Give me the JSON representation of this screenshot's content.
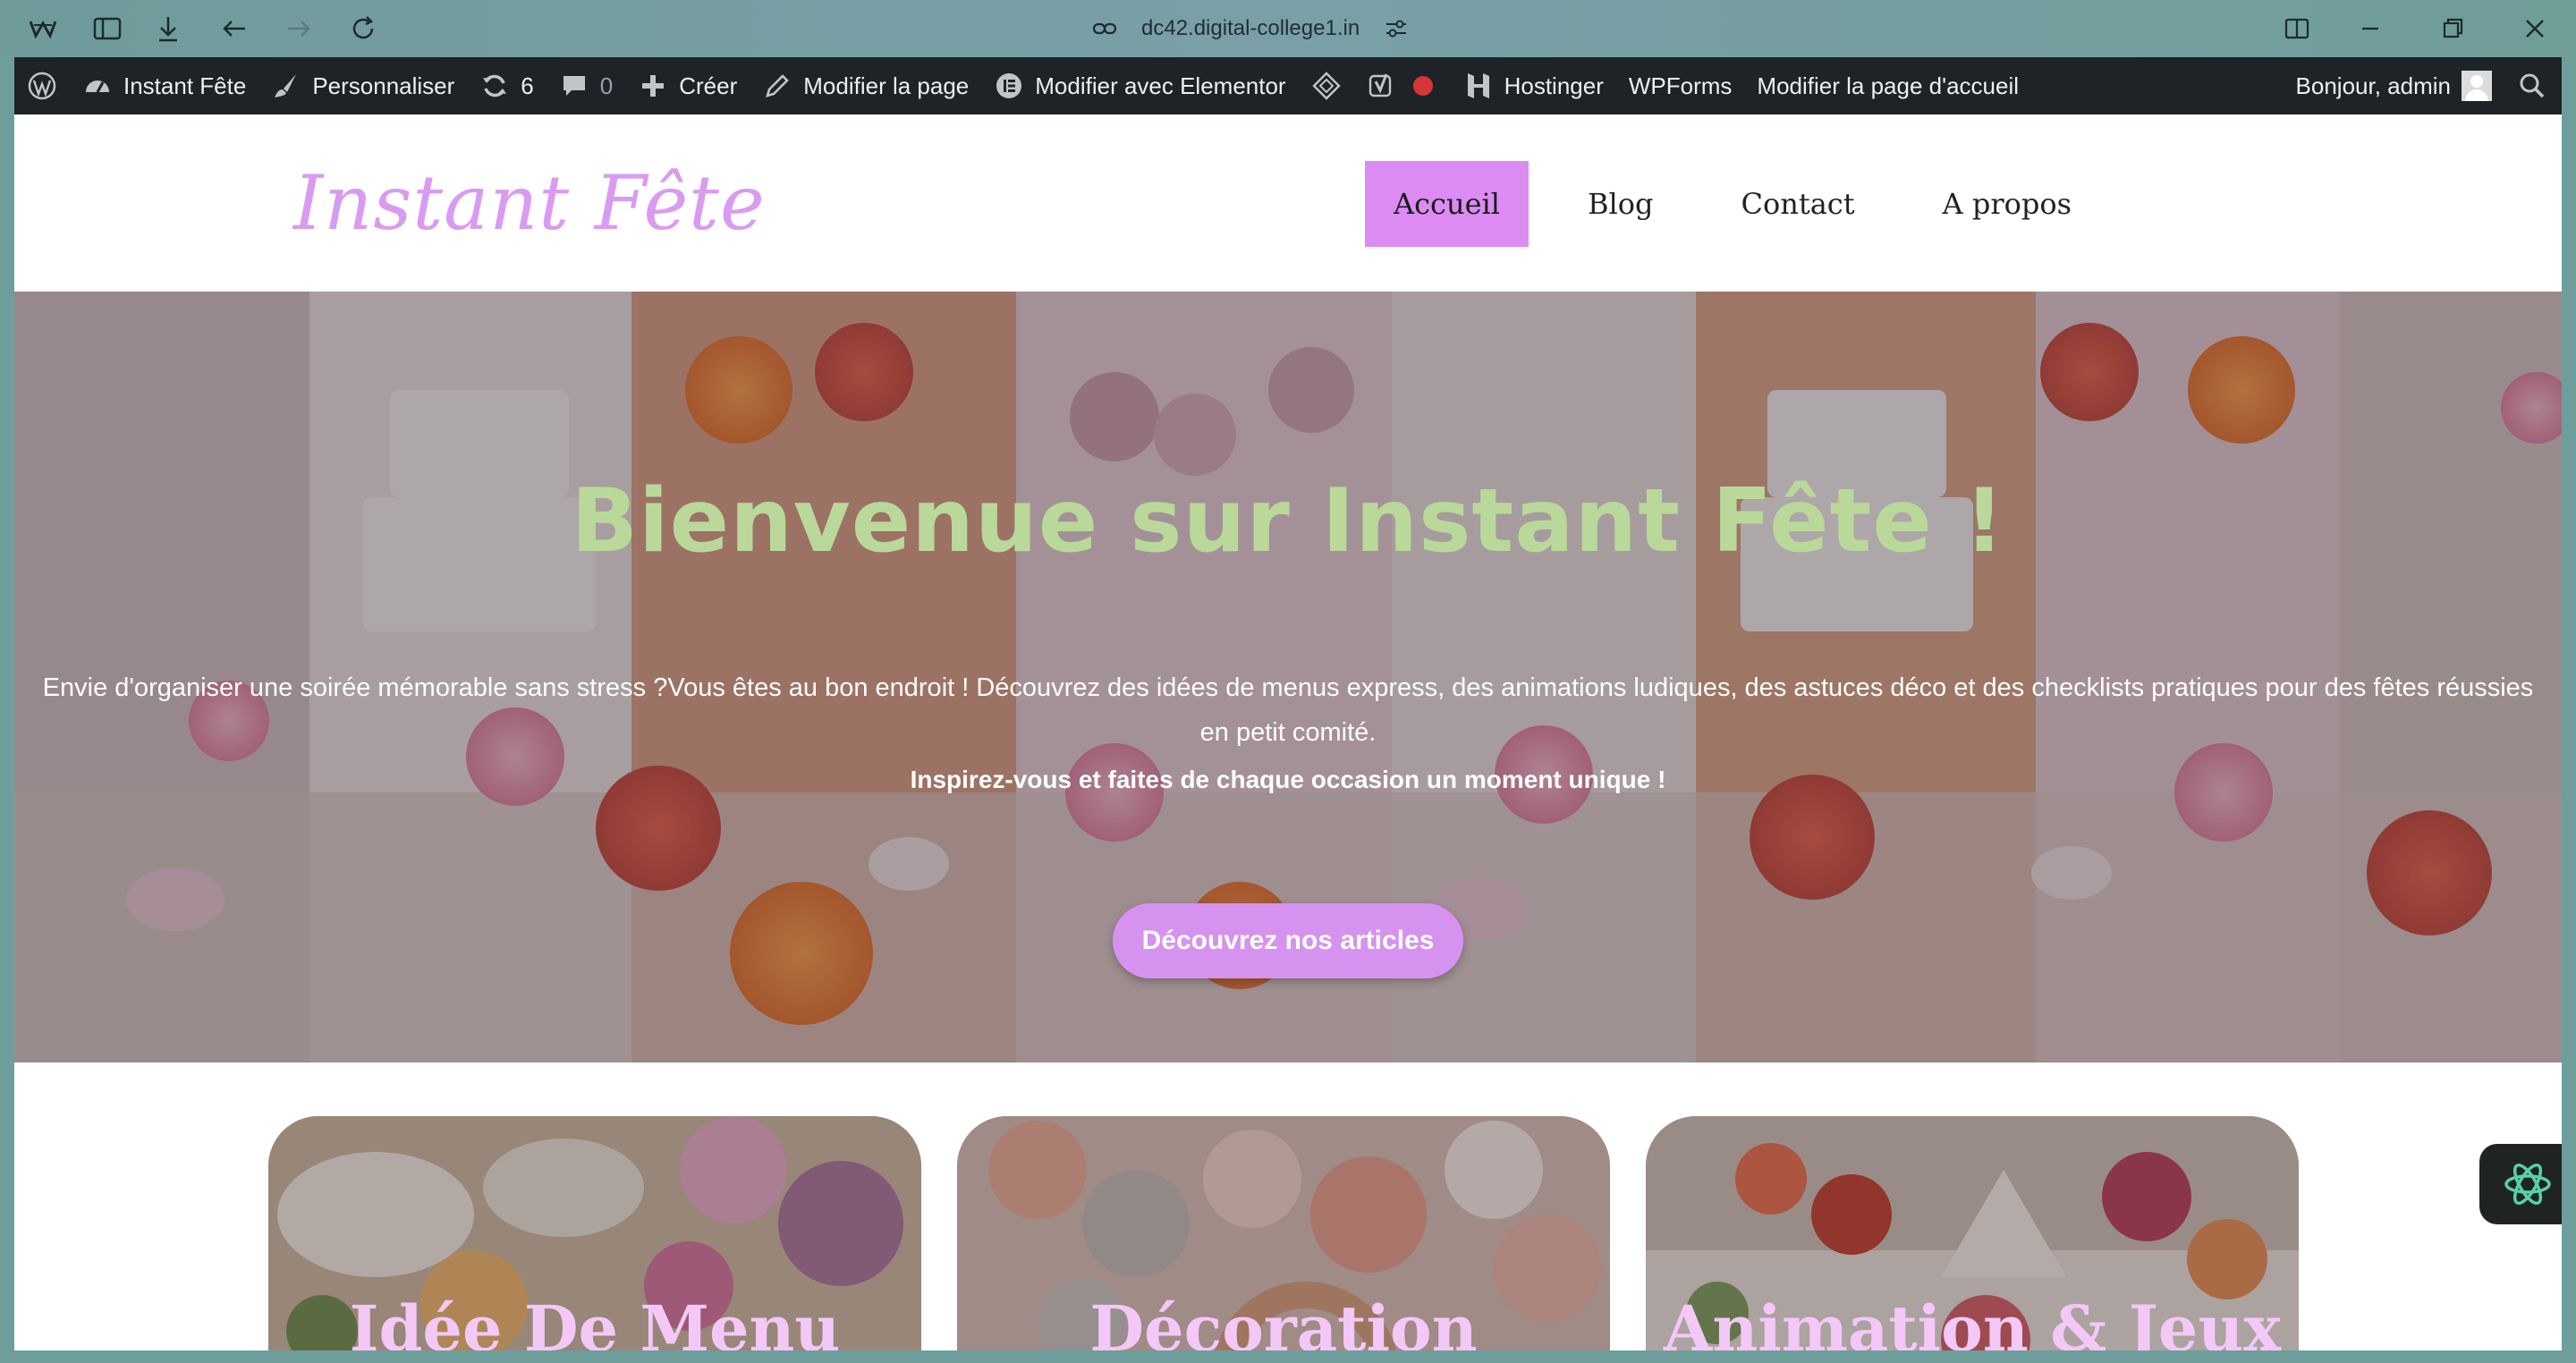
{
  "browser": {
    "url": "dc42.digital-college1.in"
  },
  "wp_admin_bar": {
    "site_name": "Instant Fête",
    "customize": "Personnaliser",
    "updates_count": "6",
    "comments_count": "0",
    "create": "Créer",
    "edit_page": "Modifier la page",
    "edit_elementor": "Modifier avec Elementor",
    "hostinger": "Hostinger",
    "wpforms": "WPForms",
    "edit_home": "Modifier la page d'accueil",
    "greeting": "Bonjour, admin"
  },
  "site": {
    "logo": "Instant Fête",
    "nav": [
      {
        "label": "Accueil",
        "active": true
      },
      {
        "label": "Blog",
        "active": false
      },
      {
        "label": "Contact",
        "active": false
      },
      {
        "label": "A propos",
        "active": false
      }
    ]
  },
  "hero": {
    "title": "Bienvenue sur Instant Fête !",
    "text": "Envie d'organiser une soirée mémorable sans stress ?Vous êtes au bon endroit ! Découvrez des idées de menus express, des animations ludiques, des astuces déco et des checklists pratiques pour des fêtes réussies en petit comité.",
    "subtext": "Inspirez-vous et faites de chaque occasion un moment unique !",
    "button": "Découvrez nos articles"
  },
  "cards": [
    {
      "title": "Idée De Menu"
    },
    {
      "title": "Décoration"
    },
    {
      "title": "Animation & Jeux"
    }
  ],
  "colors": {
    "brand_pink": "#dc8bf2",
    "hero_title_green": "#b9d89a",
    "wp_bar": "#1d2327"
  }
}
